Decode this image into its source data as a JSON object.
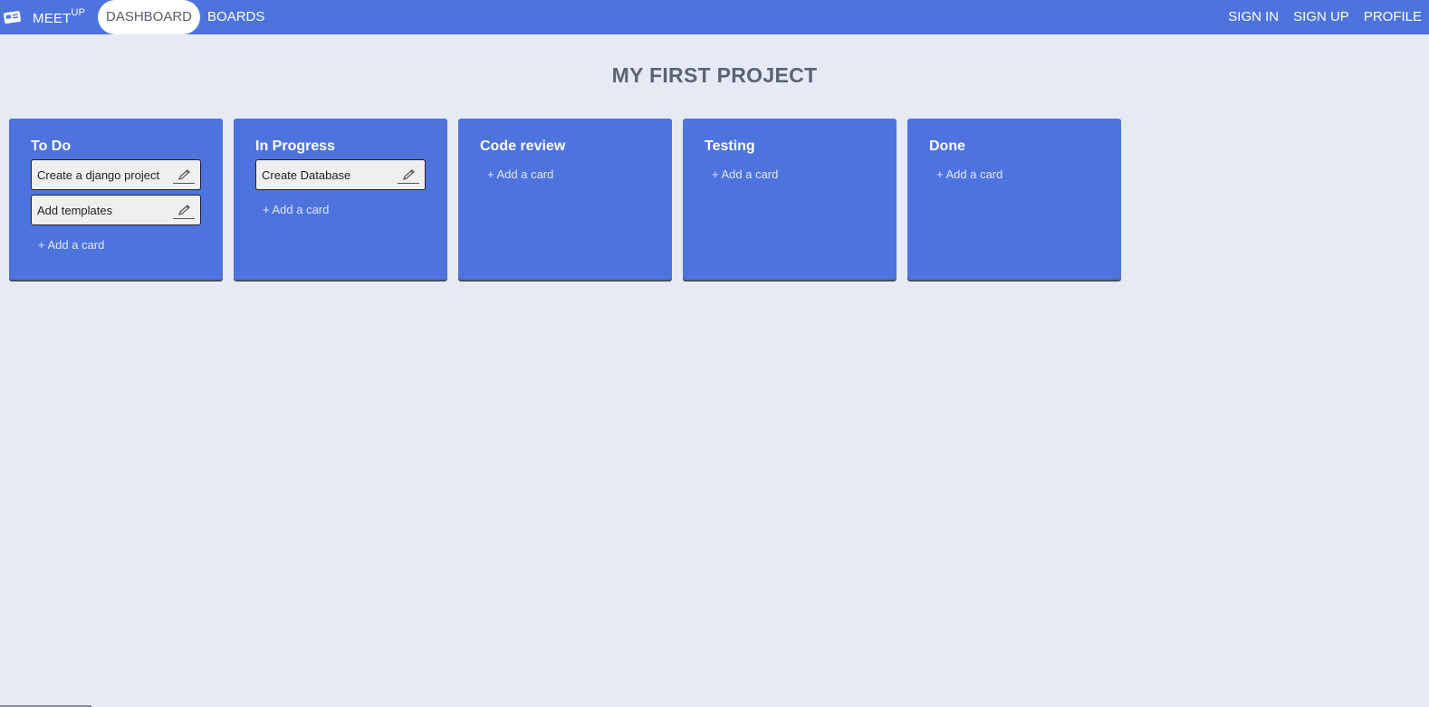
{
  "nav": {
    "brand": "MEET",
    "brand_sup": "UP",
    "left_links": [
      {
        "label": "DASHBOARD",
        "active": true
      },
      {
        "label": "BOARDS",
        "active": false
      }
    ],
    "right_links": [
      {
        "label": "SIGN IN"
      },
      {
        "label": "SIGN UP"
      },
      {
        "label": "PROFILE"
      }
    ]
  },
  "page": {
    "title": "MY FIRST PROJECT"
  },
  "columns": [
    {
      "title": "To Do",
      "cards": [
        "Create a django project",
        "Add templates"
      ],
      "add_label": "+ Add a card"
    },
    {
      "title": "In Progress",
      "cards": [
        "Create Database"
      ],
      "add_label": "+ Add a card"
    },
    {
      "title": "Code review",
      "cards": [],
      "add_label": "+ Add a card"
    },
    {
      "title": "Testing",
      "cards": [],
      "add_label": "+ Add a card"
    },
    {
      "title": "Done",
      "cards": [],
      "add_label": "+ Add a card"
    }
  ],
  "colors": {
    "primary": "#4d73df",
    "background": "#e5eaf5",
    "card": "#efefef",
    "title_text": "#5b6472"
  },
  "icons": {
    "brand": "id-card-icon",
    "card_edit": "pencil-icon"
  }
}
